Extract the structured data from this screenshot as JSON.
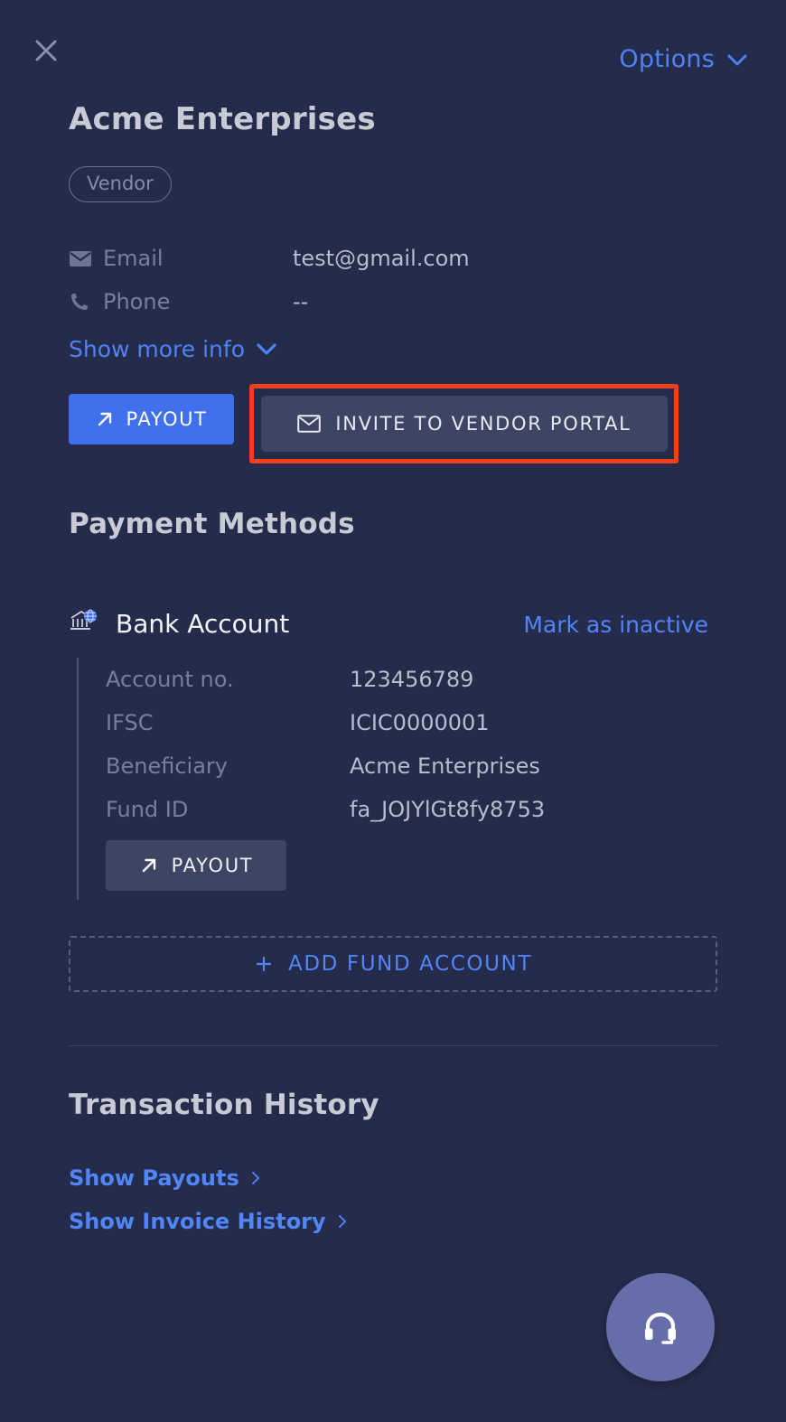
{
  "header": {
    "close_icon": "close-icon",
    "options_label": "Options",
    "options_caret": "chevron-down-icon"
  },
  "entity": {
    "name": "Acme Enterprises",
    "badge": "Vendor"
  },
  "contact": {
    "rows": [
      {
        "icon": "envelope-icon",
        "label": "Email",
        "value": "test@gmail.com"
      },
      {
        "icon": "phone-icon",
        "label": "Phone",
        "value": "--"
      }
    ],
    "show_more_label": "Show more info"
  },
  "actions": {
    "payout_label": "PAYOUT",
    "payout_icon": "arrow-up-right-icon",
    "invite_label": "INVITE TO VENDOR PORTAL",
    "invite_icon": "envelope-icon",
    "highlight_color": "#f2401b"
  },
  "payment_methods": {
    "title": "Payment Methods",
    "account": {
      "icon": "bank-globe-icon",
      "name": "Bank Account",
      "mark_inactive_label": "Mark as inactive",
      "rows": [
        {
          "label": "Account no.",
          "value": "123456789"
        },
        {
          "label": "IFSC",
          "value": "ICIC0000001"
        },
        {
          "label": "Beneficiary",
          "value": "Acme Enterprises"
        },
        {
          "label": "Fund ID",
          "value": "fa_JOJYlGt8fy8753"
        }
      ],
      "payout_label": "PAYOUT",
      "payout_icon": "arrow-up-right-icon"
    },
    "add_fund_label": "ADD FUND ACCOUNT",
    "add_fund_icon": "plus-icon"
  },
  "transaction_history": {
    "title": "Transaction History",
    "links": [
      {
        "label": "Show Payouts",
        "caret": "chevron-right-icon"
      },
      {
        "label": "Show Invoice History",
        "caret": "chevron-right-icon"
      }
    ]
  },
  "support": {
    "icon": "headset-icon",
    "color": "#666eaa"
  },
  "theme": {
    "background": "#252b4a",
    "primary_blue": "#4070ee",
    "link_blue": "#5286f8",
    "surface": "#3e4463"
  }
}
